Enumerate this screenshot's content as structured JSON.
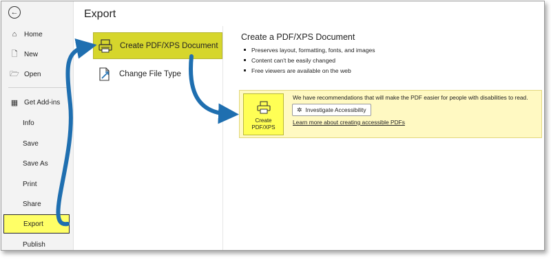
{
  "sidebar": {
    "back_icon": "back-arrow-icon",
    "items": [
      {
        "label": "Home",
        "icon": "home-icon"
      },
      {
        "label": "New",
        "icon": "new-document-icon"
      },
      {
        "label": "Open",
        "icon": "folder-open-icon"
      },
      {
        "label": "Get Add-ins",
        "icon": "add-ins-grid-icon"
      },
      {
        "label": "Info"
      },
      {
        "label": "Save"
      },
      {
        "label": "Save As"
      },
      {
        "label": "Print"
      },
      {
        "label": "Share"
      },
      {
        "label": "Export",
        "active": true
      },
      {
        "label": "Publish"
      }
    ]
  },
  "main": {
    "title": "Export",
    "options": [
      {
        "label": "Create PDF/XPS Document",
        "icon": "pdf-document-icon",
        "selected": true
      },
      {
        "label": "Change File Type",
        "icon": "change-file-type-icon"
      }
    ]
  },
  "detail": {
    "title": "Create a PDF/XPS Document",
    "bullets": [
      "Preserves layout, formatting, fonts, and images",
      "Content can't be easily changed",
      "Free viewers are available on the web"
    ],
    "create_button": {
      "line1": "Create",
      "line2": "PDF/XPS"
    },
    "recommendation": "We have recommendations that will make the PDF easier for people with disabilities to read.",
    "investigate_label": "Investigate Accessibility",
    "learn_more": "Learn more about creating accessible PDFs"
  },
  "colors": {
    "highlight": "#ffff66",
    "selected_option": "#d6d62c",
    "panel": "#fff9c2",
    "arrow": "#1f6fb0"
  }
}
